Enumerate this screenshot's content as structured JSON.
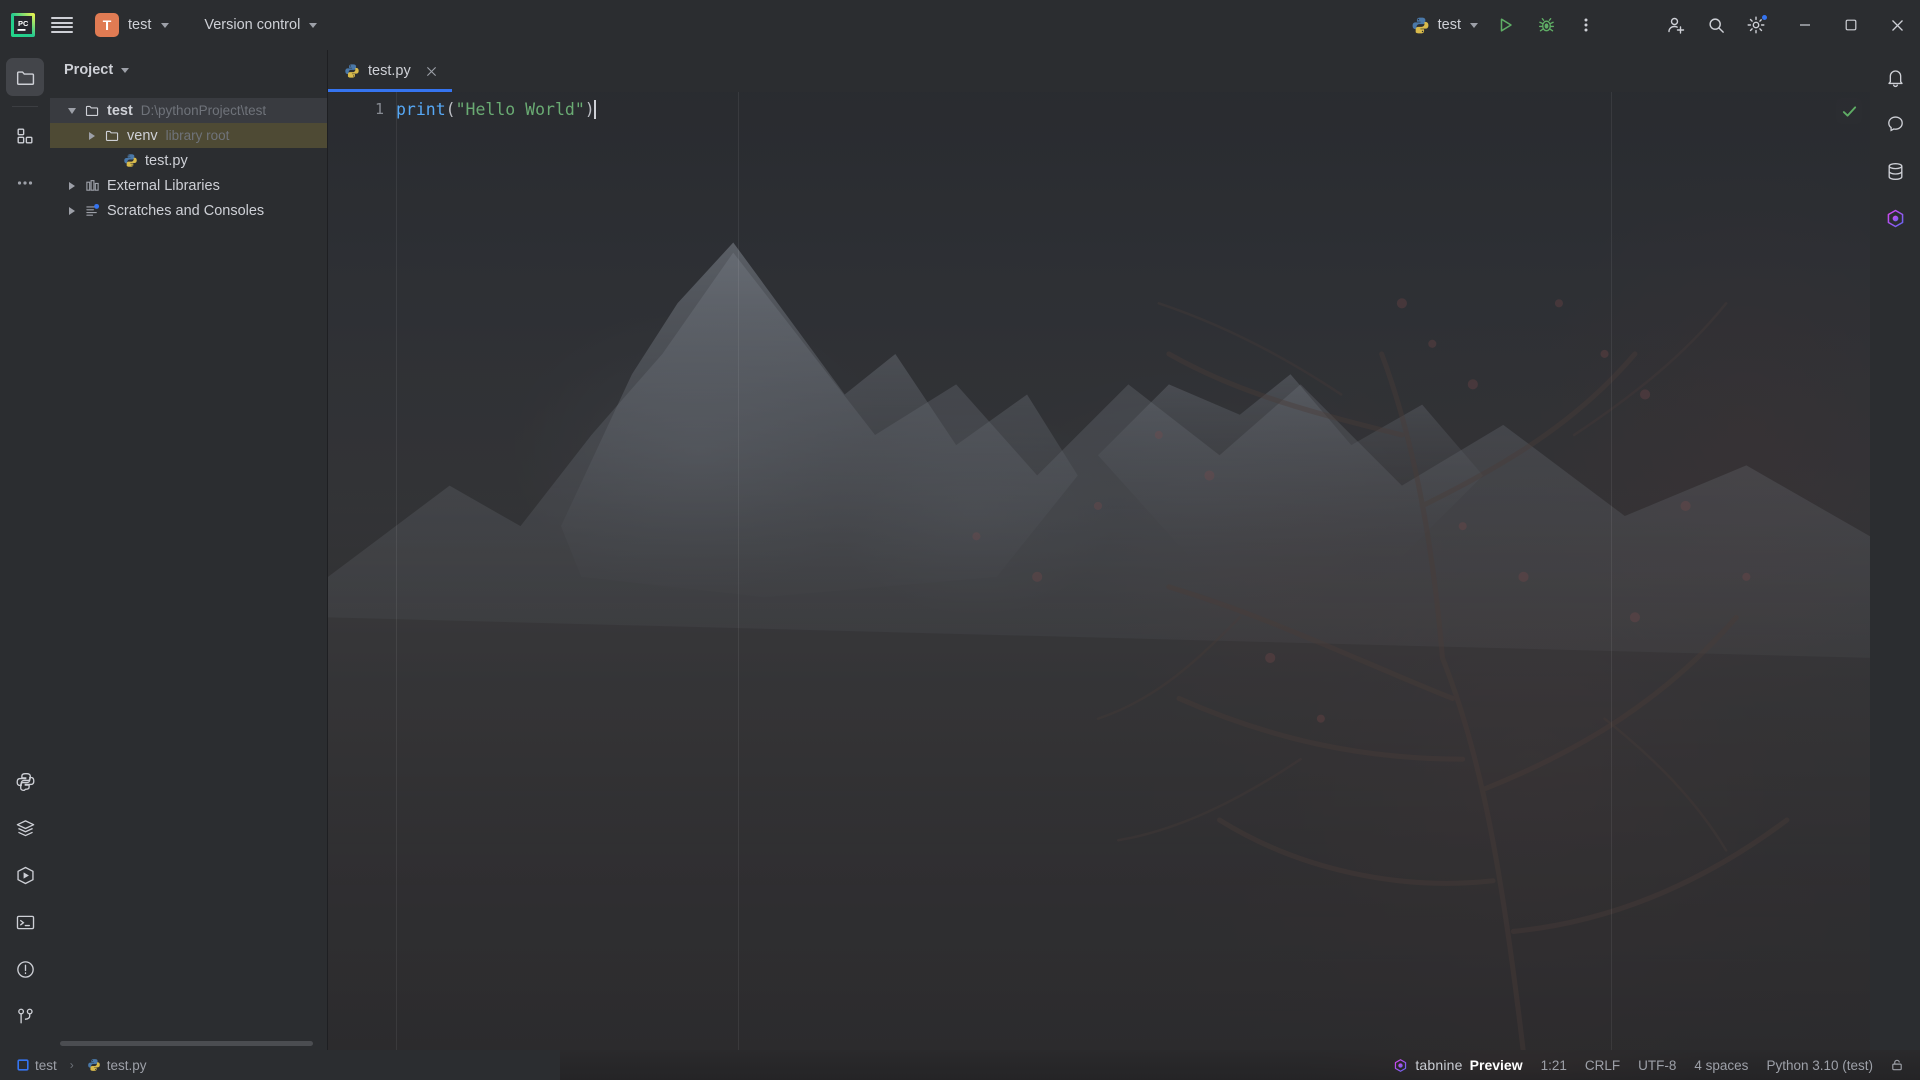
{
  "window": {
    "app_icon": "pycharm-logo",
    "menu_icon": "hamburger-menu-icon",
    "project_badge": "T",
    "project_name": "test",
    "vcs_label": "Version control",
    "run_config_name": "test",
    "run_icon": "run-icon",
    "debug_icon": "debug-icon",
    "more_icon": "more-vertical-icon",
    "account_icon": "account-add-icon",
    "search_icon": "search-icon",
    "settings_icon": "gear-icon",
    "minimize_icon": "minimize-icon",
    "maximize_icon": "maximize-icon",
    "close_icon": "close-icon"
  },
  "left_stripe": {
    "top_items": [
      {
        "name": "project-tool-window",
        "icon": "folder-icon",
        "active": true
      },
      {
        "name": "structure-tool-window",
        "icon": "structure-icon",
        "active": false
      },
      {
        "name": "more-tool-windows",
        "icon": "more-horizontal-icon",
        "active": false
      }
    ],
    "bottom_items": [
      {
        "name": "python-console",
        "icon": "python-icon"
      },
      {
        "name": "services",
        "icon": "layers-icon"
      },
      {
        "name": "run-tool-window",
        "icon": "run-hex-icon"
      },
      {
        "name": "terminal",
        "icon": "terminal-icon"
      },
      {
        "name": "problems",
        "icon": "warning-circle-icon"
      },
      {
        "name": "version-control-tool-window",
        "icon": "branch-icon"
      }
    ]
  },
  "right_stripe": {
    "items": [
      {
        "name": "notifications",
        "icon": "bell-icon"
      },
      {
        "name": "ai-assistant",
        "icon": "ai-icon"
      },
      {
        "name": "database",
        "icon": "database-icon"
      },
      {
        "name": "tabnine",
        "icon": "tabnine-icon"
      }
    ]
  },
  "project_panel": {
    "title": "Project",
    "title_chevron": "chevron-down-icon",
    "tree": [
      {
        "label": "test",
        "hint": "D:\\pythonProject\\test",
        "icon": "folder-icon",
        "twisty": "expanded",
        "indent": 0,
        "state": "focus",
        "bold": true
      },
      {
        "label": "venv",
        "hint": "library root",
        "icon": "folder-icon",
        "twisty": "collapsed",
        "indent": 1,
        "state": "selected",
        "bold": false
      },
      {
        "label": "test.py",
        "hint": "",
        "icon": "python-file-icon",
        "twisty": "none",
        "indent": 2,
        "state": "none",
        "bold": false
      },
      {
        "label": "External Libraries",
        "hint": "",
        "icon": "library-icon",
        "twisty": "collapsed",
        "indent": 0,
        "state": "none",
        "bold": false
      },
      {
        "label": "Scratches and Consoles",
        "hint": "",
        "icon": "scratches-icon",
        "twisty": "collapsed",
        "indent": 0,
        "state": "none",
        "bold": false
      }
    ]
  },
  "editor": {
    "tabs": [
      {
        "label": "test.py",
        "icon": "python-file-icon",
        "active": true,
        "close_icon": "close-icon"
      }
    ],
    "line_number": "1",
    "code_tokens": [
      {
        "text": "print",
        "type": "function"
      },
      {
        "text": "(",
        "type": "paren"
      },
      {
        "text": "\"Hello World\"",
        "type": "string"
      },
      {
        "text": ")",
        "type": "paren"
      }
    ],
    "code_plain": "print(\"Hello World\")",
    "inspection_icon": "inspection-ok-icon",
    "inspection_color": "#5fad65"
  },
  "status_bar": {
    "breadcrumbs": [
      {
        "label": "test",
        "icon": "module-icon"
      },
      {
        "label": "test.py",
        "icon": "python-file-icon"
      }
    ],
    "breadcrumb_separator": "›",
    "tabnine_icon": "tabnine-icon",
    "tabnine_lower": "tabnine",
    "tabnine_label": "Preview",
    "caret_position": "1:21",
    "line_separator": "CRLF",
    "encoding": "UTF-8",
    "indent": "4 spaces",
    "interpreter": "Python 3.10 (test)",
    "lock_icon": "lock-icon"
  },
  "colors": {
    "accent": "#3574f0",
    "selection": "#4e4a34",
    "panel_bg": "#2b2d30",
    "text": "#ced0d6",
    "muted": "#6f737a",
    "string": "#6aab73",
    "function": "#56a8f5",
    "green": "#5fad65",
    "project_badge_bg": "#e07b53"
  }
}
